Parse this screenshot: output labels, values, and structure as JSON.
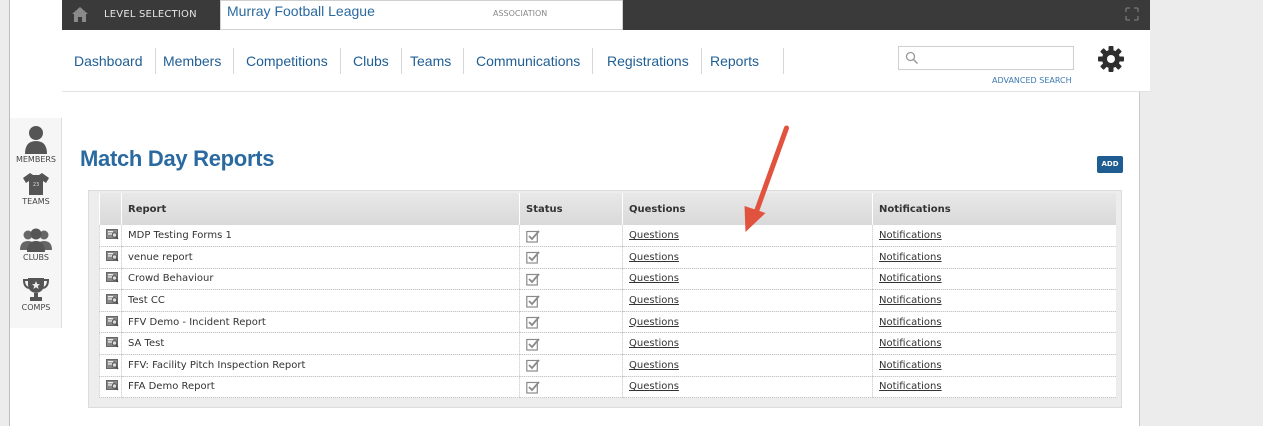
{
  "topbar": {
    "level_label": "LEVEL SELECTION",
    "org_name": "Murray Football League",
    "org_type": "ASSOCIATION"
  },
  "nav": {
    "items": [
      {
        "label": "Dashboard"
      },
      {
        "label": "Members"
      },
      {
        "label": "Competitions"
      },
      {
        "label": "Clubs"
      },
      {
        "label": "Teams"
      },
      {
        "label": "Communications"
      },
      {
        "label": "Registrations"
      },
      {
        "label": "Reports"
      }
    ],
    "search_placeholder": "",
    "advanced_search": "ADVANCED SEARCH"
  },
  "sidebar": {
    "items": [
      {
        "label": "MEMBERS",
        "icon": "member-icon"
      },
      {
        "label": "TEAMS",
        "icon": "jersey-icon"
      },
      {
        "label": "CLUBS",
        "icon": "group-icon"
      },
      {
        "label": "COMPS",
        "icon": "trophy-icon"
      }
    ]
  },
  "page": {
    "title": "Match Day Reports",
    "add_label": "ADD"
  },
  "table": {
    "headers": {
      "report": "Report",
      "status": "Status",
      "questions": "Questions",
      "notifications": "Notifications"
    },
    "rows": [
      {
        "report": "MDP Testing Forms 1",
        "questions": "Questions",
        "notifications": "Notifications"
      },
      {
        "report": "venue report",
        "questions": "Questions",
        "notifications": "Notifications"
      },
      {
        "report": "Crowd Behaviour",
        "questions": "Questions",
        "notifications": "Notifications"
      },
      {
        "report": "Test CC",
        "questions": "Questions",
        "notifications": "Notifications"
      },
      {
        "report": "FFV Demo - Incident Report",
        "questions": "Questions",
        "notifications": "Notifications"
      },
      {
        "report": "SA Test",
        "questions": "Questions",
        "notifications": "Notifications"
      },
      {
        "report": "FFV: Facility Pitch Inspection Report",
        "questions": "Questions",
        "notifications": "Notifications"
      },
      {
        "report": "FFA Demo Report",
        "questions": "Questions",
        "notifications": "Notifications"
      }
    ]
  },
  "colors": {
    "accent": "#1f5e94",
    "topbar": "#3a3a3a",
    "arrow": "#e2533f"
  }
}
